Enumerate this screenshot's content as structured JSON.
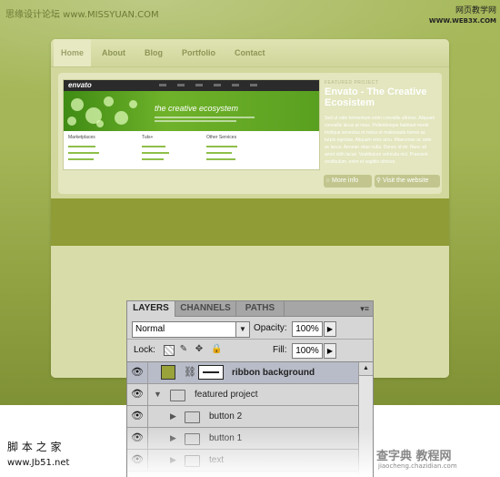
{
  "watermarks": {
    "top_left": "思缘设计论坛 www.MISSYUAN.COM",
    "top_right_line1": "网页教学网",
    "top_right_line2": "WWW.WEB3X.COM",
    "bottom_left": "脚 本 之 家",
    "bottom_left_url": "www.Jb51.net",
    "bottom_right": "查字典 教程网",
    "bottom_right_url": "jiaocheng.chazidian.com"
  },
  "site": {
    "nav": [
      "Home",
      "About",
      "Blog",
      "Portfolio",
      "Contact"
    ],
    "active_nav": "Home",
    "featured": {
      "label": "FEATURED PROJECT",
      "title": "Envato - The Creative Ecosistem",
      "body": "Sed ut odio fermentum enim convallis ultrices. Aliquam convallis lacus at risus. Pellentesque habitant morbi tristique senectus et netus et malesuada fames ac turpis egestas. Aliquam eros arcu. Maecenas ac ante ac lacus. Aenean vitae nulla. Donec id mi. Nunc sit amet nibh lacus. Vestibulum vehicula nisl. Praesent vestibulum, enim et sagittis ultrices.",
      "more_info": "More info",
      "visit": "Visit the website"
    },
    "screenshot": {
      "logo": "envato",
      "tagline": "the creative ecosystem",
      "col1": "Marketplaces",
      "col2": "Tuts+",
      "col3": "Other Services"
    }
  },
  "layers_panel": {
    "tabs": [
      "LAYERS",
      "CHANNELS",
      "PATHS"
    ],
    "active_tab": "LAYERS",
    "blend_mode": "Normal",
    "opacity_label": "Opacity:",
    "opacity": "100%",
    "lock_label": "Lock:",
    "fill_label": "Fill:",
    "fill": "100%",
    "layers": [
      {
        "name": "ribbon background",
        "type": "layer",
        "selected": true
      },
      {
        "name": "featured project",
        "type": "group",
        "expanded": true
      },
      {
        "name": "button 2",
        "type": "group",
        "expanded": false
      },
      {
        "name": "button 1",
        "type": "group",
        "expanded": false
      },
      {
        "name": "text",
        "type": "group",
        "expanded": false
      }
    ]
  }
}
